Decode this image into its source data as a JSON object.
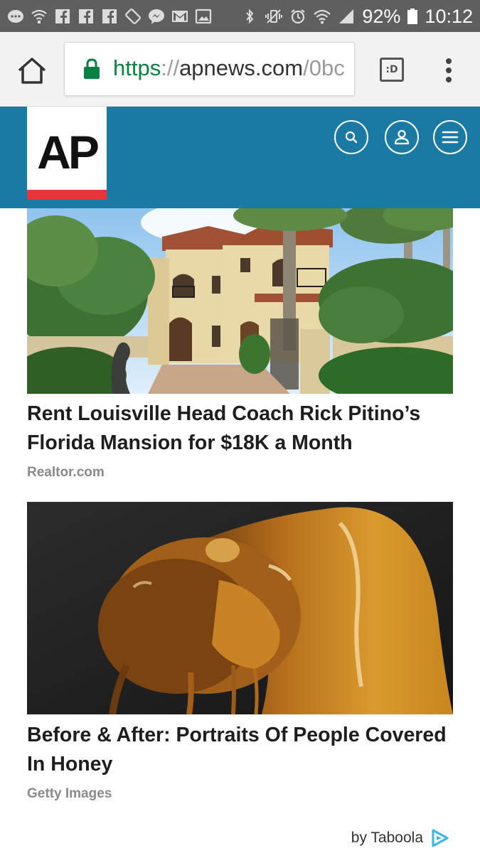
{
  "status_bar": {
    "battery": "92%",
    "time": "10:12",
    "left_icons": [
      "messages-icon",
      "wifi-calling-icon",
      "facebook-icon",
      "facebook-icon",
      "facebook-icon",
      "screen-rotation-icon",
      "messenger-icon",
      "gmail-icon",
      "gallery-icon"
    ],
    "right_icons": [
      "bluetooth-icon",
      "vibrate-icon",
      "alarm-icon",
      "wifi-icon",
      "signal-icon",
      "battery-icon"
    ]
  },
  "browser": {
    "url_scheme": "https",
    "url_separator": "://",
    "url_host": "apnews.com",
    "url_path": "/0bc",
    "reader_label": ":D"
  },
  "header": {
    "logo_text": "AP",
    "colors": {
      "header_bg": "#1b7aa3",
      "logo_accent": "#e7353a"
    }
  },
  "articles": [
    {
      "title": "Rent Louisville Head Coach Rick Pitino’s Florida Mansion for $18K a Month",
      "source": "Realtor.com"
    },
    {
      "title": "Before & After: Portraits Of People Covered In Honey",
      "source": "Getty Images"
    }
  ],
  "footer": {
    "attribution": "by Taboola"
  }
}
